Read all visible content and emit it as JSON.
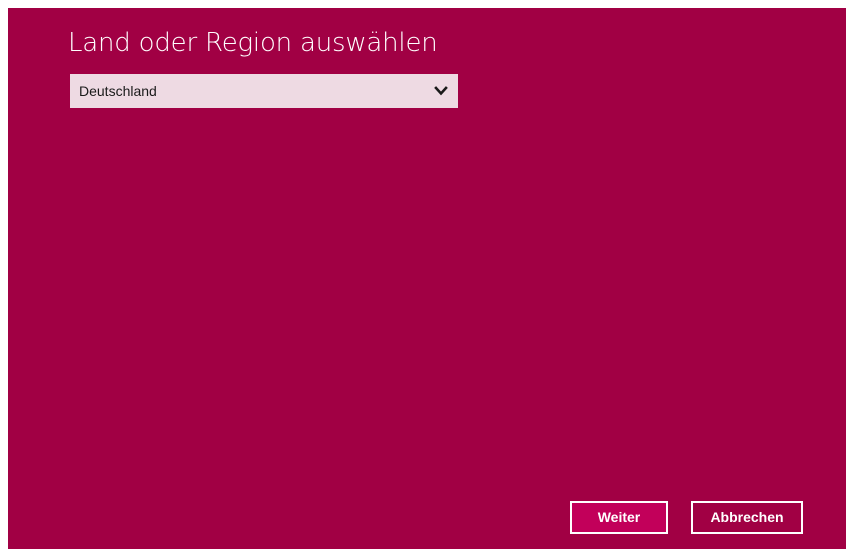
{
  "dialog": {
    "title": "Land oder Region auswählen"
  },
  "region_select": {
    "selected_value": "Deutschland",
    "icon": "chevron-down-icon"
  },
  "buttons": {
    "next_label": "Weiter",
    "cancel_label": "Abbrechen"
  },
  "colors": {
    "background": "#a10044",
    "primary_button": "#c2005a",
    "select_background": "#eedae3",
    "text_light": "#ffffff"
  }
}
